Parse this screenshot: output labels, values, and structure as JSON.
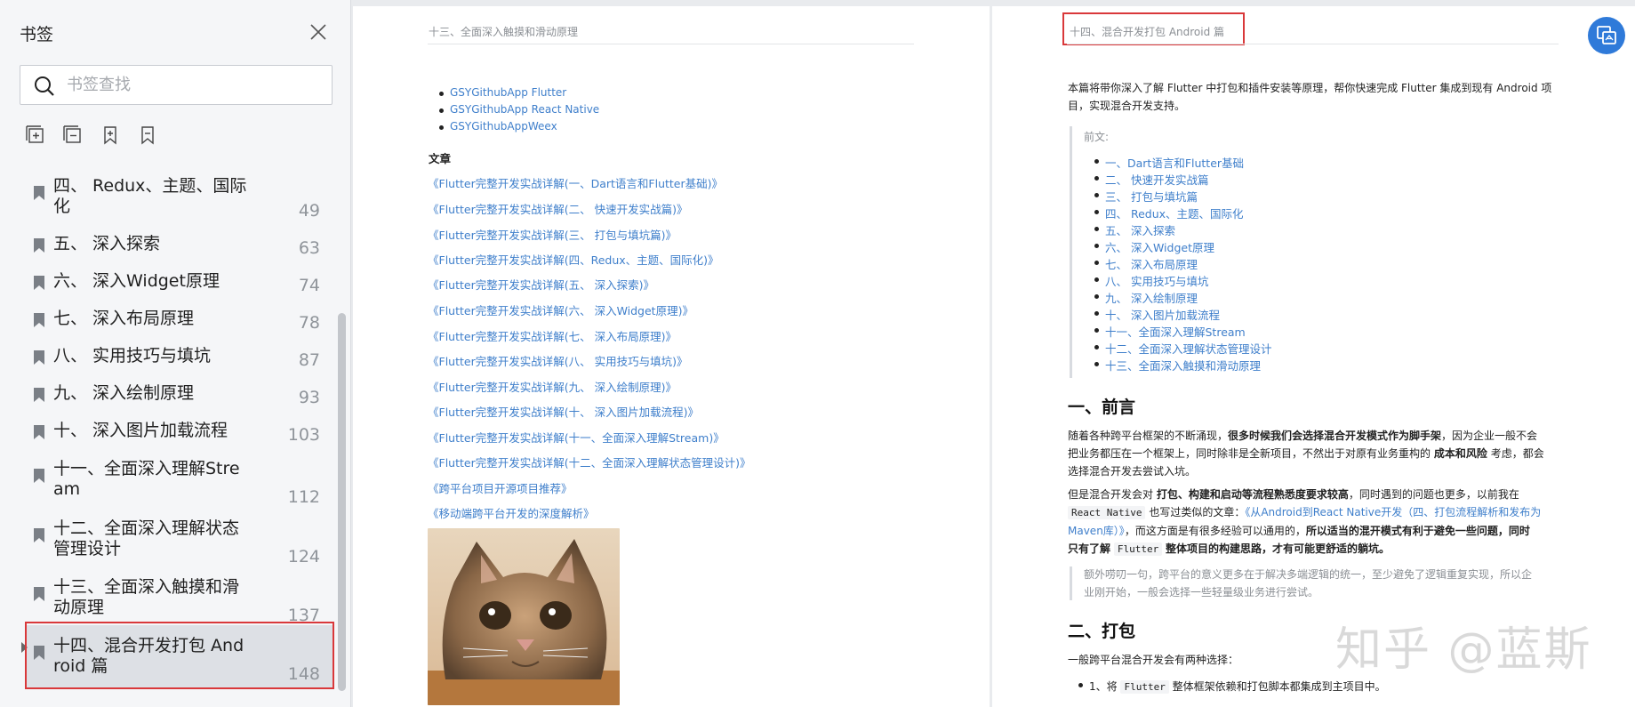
{
  "sidebar": {
    "title": "书签",
    "search_placeholder": "书签查找",
    "items": [
      {
        "label": "四、 Redux、主题、国际化",
        "page": "49"
      },
      {
        "label": "五、 深入探索",
        "page": "63"
      },
      {
        "label": "六、 深入Widget原理",
        "page": "74"
      },
      {
        "label": "七、 深入布局原理",
        "page": "78"
      },
      {
        "label": "八、 实用技巧与填坑",
        "page": "87"
      },
      {
        "label": "九、 深入绘制原理",
        "page": "93"
      },
      {
        "label": "十、 深入图片加载流程",
        "page": "103"
      },
      {
        "label": "十一、全面深入理解Stream",
        "page": "112"
      },
      {
        "label": "十二、全面深入理解状态管理设计",
        "page": "124"
      },
      {
        "label": "十三、全面深入触摸和滑动原理",
        "page": "137"
      },
      {
        "label": "十四、混合开发打包 Android 篇",
        "page": "148"
      }
    ]
  },
  "left_page": {
    "header": "十三、全面深入触摸和滑动原理",
    "bullets": [
      "GSYGithubApp Flutter",
      "GSYGithubApp React Native",
      "GSYGithubAppWeex"
    ],
    "section_label": "文章",
    "articles": [
      "《Flutter完整开发实战详解(一、Dart语言和Flutter基础)》",
      "《Flutter完整开发实战详解(二、 快速开发实战篇)》",
      "《Flutter完整开发实战详解(三、 打包与填坑篇)》",
      "《Flutter完整开发实战详解(四、Redux、主题、国际化)》",
      "《Flutter完整开发实战详解(五、 深入探索)》",
      "《Flutter完整开发实战详解(六、 深入Widget原理)》",
      "《Flutter完整开发实战详解(七、 深入布局原理)》",
      "《Flutter完整开发实战详解(八、 实用技巧与填坑)》",
      "《Flutter完整开发实战详解(九、 深入绘制原理)》",
      "《Flutter完整开发实战详解(十、 深入图片加载流程)》",
      "《Flutter完整开发实战详解(十一、全面深入理解Stream)》",
      "《Flutter完整开发实战详解(十二、全面深入理解状态管理设计)》",
      "《跨平台项目开源项目推荐》",
      "《移动端跨平台开发的深度解析》"
    ]
  },
  "right_page": {
    "header": "十四、混合开发打包 Android 篇",
    "intro_line1": "本篇将带你深入了解 Flutter 中打包和插件安装等原理，帮你快速完成 Flutter 集成到现有 Android 项",
    "intro_line2": "目，实现混合开发支持。",
    "preface_label": "前文:",
    "toc": [
      "一、Dart语言和Flutter基础",
      "二、 快速开发实战篇",
      "三、 打包与填坑篇",
      "四、 Redux、主题、国际化",
      "五、 深入探索",
      "六、 深入Widget原理",
      "七、 深入布局原理",
      "八、 实用技巧与填坑",
      "九、 深入绘制原理",
      "十、 深入图片加载流程",
      "十一、全面深入理解Stream",
      "十二、全面深入理解状态管理设计",
      "十三、全面深入触摸和滑动原理"
    ],
    "h_preface": "一、前言",
    "p1_a": "随着各种跨平台框架的不断涌现，",
    "p1_b": "很多时候我们会选择混合开发模式作为脚手架",
    "p1_c": "，因为企业一般不会",
    "p1_line2": "把业务都压在一个框架上，同时除非是全新项目，不然出于对原有业务重构的",
    "p1_line2_b": "成本和风险",
    "p1_line2_c": "考虑，都会",
    "p1_line3": "选择混合开发去尝试入坑。",
    "p2_a": "但是混合开发会对",
    "p2_b": "打包、构建和启动等流程熟悉度要求较高",
    "p2_c": "，同时遇到的问题也更多，以前我在",
    "p2_code1": "React Native",
    "p2_d": "也写过类似的文章：",
    "p2_link": "《从Android到React Native开发（四、打包流程解析和发布为",
    "p2_link2": "Maven库）》",
    "p2_e": "，而这方面是有很多经验可以通用的，",
    "p2_f": "所以适当的混开模式有利于避免一些问题，同时",
    "p2_g": "只有了解",
    "p2_code2": "Flutter",
    "p2_h": "整体项目的构建思路，才有可能更舒适的躺坑。",
    "quote_line1": "额外唠叨一句，跨平台的意义更多在于解决多端逻辑的统一，至少避免了逻辑重复实现，所以企",
    "quote_line2": "业刚开始，一般会选择一些轻量级业务进行尝试。",
    "h_pack": "二、打包",
    "p3": "一般跨平台混合开发会有两种选择：",
    "list1_a": "1、将",
    "list1_code": "Flutter",
    "list1_b": "整体框架依赖和打包脚本都集成到主项目中。"
  },
  "watermark": "知乎 @蓝斯",
  "colors": {
    "accent": "#2f7ad9",
    "link": "#3f7fcb",
    "highlight": "#d9383a"
  }
}
